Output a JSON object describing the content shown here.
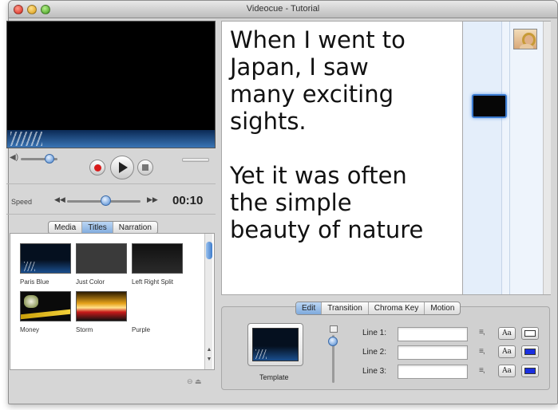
{
  "window": {
    "title": "Videocue - Tutorial"
  },
  "speed": {
    "label": "Speed",
    "timecode": "00:10"
  },
  "library_tabs": [
    {
      "label": "Media",
      "active": false
    },
    {
      "label": "Titles",
      "active": true
    },
    {
      "label": "Narration",
      "active": false
    }
  ],
  "library_items": [
    {
      "label": "Paris Blue"
    },
    {
      "label": "Just Color"
    },
    {
      "label": "Left Right Split"
    },
    {
      "label": "Money"
    },
    {
      "label": "Storm"
    },
    {
      "label": "Purple"
    }
  ],
  "script_lines": [
    "When I went to",
    "Japan, I saw",
    "many exciting",
    "sights.",
    "",
    "Yet it was often",
    "the simple",
    "beauty of nature"
  ],
  "edit_tabs": [
    {
      "label": "Edit",
      "active": true
    },
    {
      "label": "Transition",
      "active": false
    },
    {
      "label": "Chroma Key",
      "active": false
    },
    {
      "label": "Motion",
      "active": false
    }
  ],
  "template": {
    "label": "Template"
  },
  "lines": [
    {
      "label": "Line 1:",
      "value": "",
      "font_button": "Aa",
      "color": "#ffffff"
    },
    {
      "label": "Line 2:",
      "value": "",
      "font_button": "Aa",
      "color": "#1a2fe0"
    },
    {
      "label": "Line 3:",
      "value": "",
      "font_button": "Aa",
      "color": "#1a2fe0"
    }
  ],
  "colors": {
    "accent": "#7ea9dd",
    "video_bg": "#000000"
  },
  "icons": {
    "window_controls": [
      "close-icon",
      "minimize-icon",
      "zoom-icon"
    ],
    "transport": [
      "record-icon",
      "play-icon",
      "stop-icon"
    ],
    "volume": "volume-icon",
    "speed": [
      "slow-icon",
      "fast-icon"
    ]
  }
}
